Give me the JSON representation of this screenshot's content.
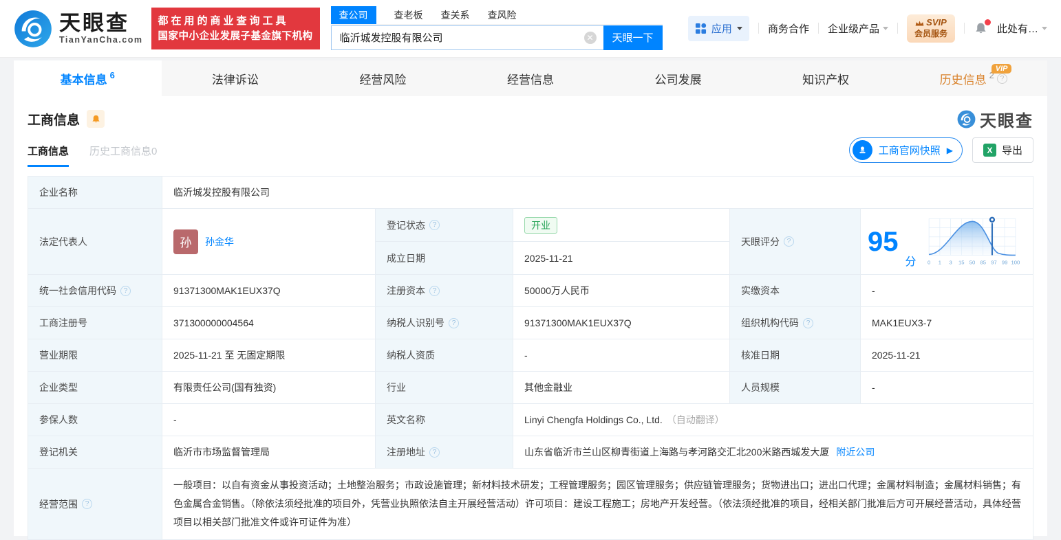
{
  "brand": {
    "logo_text": "天眼查",
    "logo_domain": "TianYanCha.com",
    "promo_line1": "都在用的商业查询工具",
    "promo_line2": "国家中小企业发展子基金旗下机构"
  },
  "search": {
    "tabs": [
      "查公司",
      "查老板",
      "查关系",
      "查风险"
    ],
    "value": "临沂城发控股有限公司",
    "button_label": "天眼一下"
  },
  "topnav": {
    "apps_label": "应用",
    "coop_label": "商务合作",
    "enterprise_label": "企业级产品",
    "svip_line1": "SVIP",
    "svip_line2": "会员服务",
    "user_label": "此处有…"
  },
  "nav_tabs": [
    {
      "label": "基本信息",
      "count": "6"
    },
    {
      "label": "法律诉讼",
      "count": ""
    },
    {
      "label": "经营风险",
      "count": ""
    },
    {
      "label": "经营信息",
      "count": ""
    },
    {
      "label": "公司发展",
      "count": ""
    },
    {
      "label": "知识产权",
      "count": ""
    },
    {
      "label": "历史信息",
      "count": "2",
      "vip": "VIP"
    }
  ],
  "section": {
    "title": "工商信息",
    "watermark": "天眼查",
    "subtab_active": "工商信息",
    "subtab_history": "历史工商信息0",
    "snapshot_label": "工商官网快照",
    "export_label": "导出"
  },
  "fields": {
    "name": {
      "label": "企业名称",
      "value": "临沂城发控股有限公司"
    },
    "legal_rep": {
      "label": "法定代表人",
      "avatar": "孙",
      "person": "孙金华"
    },
    "status": {
      "label": "登记状态",
      "value": "开业"
    },
    "established": {
      "label": "成立日期",
      "value": "2025-11-21"
    },
    "credit_code": {
      "label": "统一社会信用代码",
      "value": "91371300MAK1EUX37Q"
    },
    "reg_capital": {
      "label": "注册资本",
      "value": "50000万人民币"
    },
    "paid_capital": {
      "label": "实缴资本",
      "value": "-"
    },
    "reg_no": {
      "label": "工商注册号",
      "value": "371300000004564"
    },
    "taxpayer_no": {
      "label": "纳税人识别号",
      "value": "91371300MAK1EUX37Q"
    },
    "org_code": {
      "label": "组织机构代码",
      "value": "MAK1EUX3-7"
    },
    "term": {
      "label": "营业期限",
      "value": "2025-11-21 至 无固定期限"
    },
    "taxpayer_quality": {
      "label": "纳税人资质",
      "value": "-"
    },
    "approved": {
      "label": "核准日期",
      "value": "2025-11-21"
    },
    "type": {
      "label": "企业类型",
      "value": "有限责任公司(国有独资)"
    },
    "industry": {
      "label": "行业",
      "value": "其他金融业"
    },
    "staff": {
      "label": "人员规模",
      "value": "-"
    },
    "insured": {
      "label": "参保人数",
      "value": "-"
    },
    "en_name": {
      "label": "英文名称",
      "value": "Linyi Chengfa Holdings Co., Ltd.",
      "note": "（自动翻译）"
    },
    "authority": {
      "label": "登记机关",
      "value": "临沂市市场监督管理局"
    },
    "address": {
      "label": "注册地址",
      "value": "山东省临沂市兰山区柳青街道上海路与孝河路交汇北200米路西城发大厦",
      "link": "附近公司"
    },
    "scope": {
      "label": "经营范围",
      "value": "一般项目：以自有资金从事投资活动；土地整治服务；市政设施管理；新材料技术研发；工程管理服务；园区管理服务；供应链管理服务；货物进出口；进出口代理；金属材料制造；金属材料销售；有色金属合金销售。（除依法须经批准的项目外，凭营业执照依法自主开展经营活动）许可项目：建设工程施工；房地产开发经营。（依法须经批准的项目，经相关部门批准后方可开展经营活动，具体经营项目以相关部门批准文件或许可证件为准）"
    }
  },
  "score": {
    "label": "天眼评分",
    "value": "95",
    "unit": "分",
    "axis": [
      "0",
      "1",
      "3",
      "15",
      "50",
      "85",
      "97",
      "99",
      "100"
    ]
  },
  "chart_data": {
    "type": "area",
    "title": "天眼评分分布曲线",
    "x": [
      0,
      1,
      3,
      15,
      50,
      85,
      97,
      99,
      100
    ],
    "marker_value": 95,
    "shape": "bell-curve peaking near tick 50",
    "legend_position": "none",
    "grid": true
  }
}
